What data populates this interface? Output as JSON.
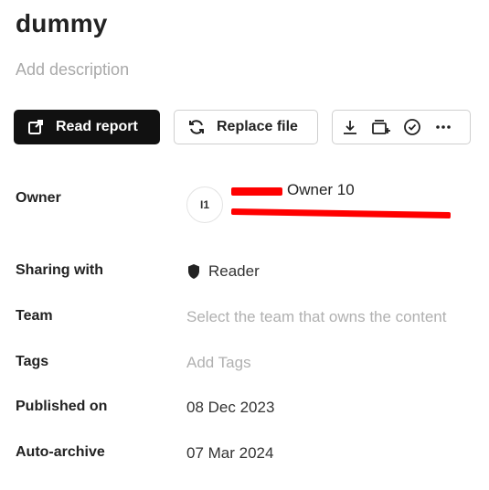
{
  "header": {
    "title": "dummy",
    "description_placeholder": "Add description"
  },
  "toolbar": {
    "read_report_label": "Read report",
    "replace_file_label": "Replace file",
    "icons": [
      "download-icon",
      "add-to-collection-icon",
      "approve-check-icon",
      "more-options-icon"
    ]
  },
  "details": {
    "owner": {
      "label": "Owner",
      "avatar_initials": "I1",
      "name": "Owner 10",
      "email": "(redacted)"
    },
    "sharing": {
      "label": "Sharing with",
      "value": "Reader"
    },
    "team": {
      "label": "Team",
      "placeholder": "Select the team that owns the content"
    },
    "tags": {
      "label": "Tags",
      "placeholder": "Add Tags"
    },
    "published": {
      "label": "Published on",
      "value": "08 Dec 2023"
    },
    "auto_archive": {
      "label": "Auto-archive",
      "value": "07 Mar 2024"
    }
  },
  "colors": {
    "primary_button": "#111111",
    "redaction": "#ff0000",
    "placeholder": "#b0b0b0"
  }
}
